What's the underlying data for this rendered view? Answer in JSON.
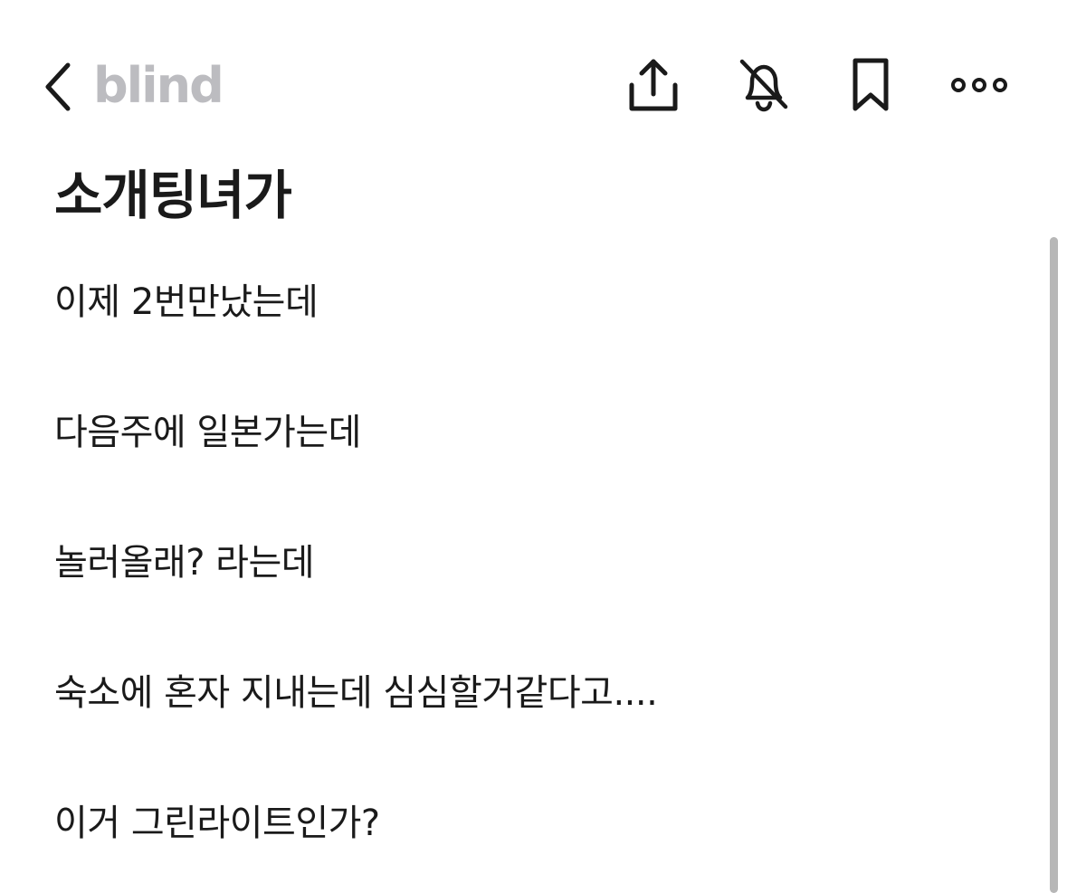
{
  "header": {
    "brand": "blind",
    "icons": {
      "back": "chevron-left-icon",
      "share": "share-icon",
      "notifications": "bell-off-icon",
      "bookmark": "bookmark-icon",
      "more": "more-horizontal-icon"
    }
  },
  "post": {
    "title": "소개팅녀가",
    "body_lines": [
      "이제 2번만났는데",
      "다음주에 일본가는데",
      "놀러올래? 라는데",
      "숙소에 혼자 지내는데 심심할거같다고....",
      "이거 그린라이트인가?"
    ]
  },
  "colors": {
    "brand": "#bcbcc0",
    "text": "#1a1a1a",
    "scrollbar": "#b7b7b7",
    "background": "#ffffff"
  }
}
